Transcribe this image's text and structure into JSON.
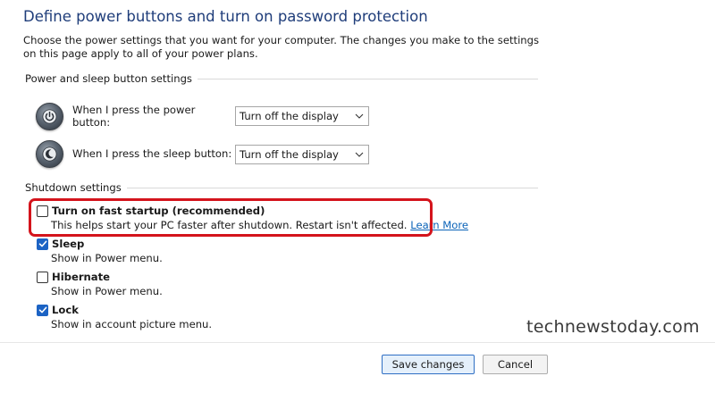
{
  "page": {
    "title": "Define power buttons and turn on password protection",
    "intro": "Choose the power settings that you want for your computer. The changes you make to the settings on this page apply to all of your power plans."
  },
  "power_sleep": {
    "header": "Power and sleep button settings",
    "power_button": {
      "label": "When I press the power button:",
      "value": "Turn off the display",
      "icon": "power-icon"
    },
    "sleep_button": {
      "label": "When I press the sleep button:",
      "value": "Turn off the display",
      "icon": "sleep-icon"
    }
  },
  "shutdown": {
    "header": "Shutdown settings",
    "fast_startup": {
      "title": "Turn on fast startup (recommended)",
      "desc": "This helps start your PC faster after shutdown. Restart isn't affected.",
      "link": "Learn More",
      "checked": false
    },
    "sleep": {
      "title": "Sleep",
      "desc": "Show in Power menu.",
      "checked": true
    },
    "hibernate": {
      "title": "Hibernate",
      "desc": "Show in Power menu.",
      "checked": false
    },
    "lock": {
      "title": "Lock",
      "desc": "Show in account picture menu.",
      "checked": true
    }
  },
  "footer": {
    "save_label": "Save changes",
    "cancel_label": "Cancel"
  },
  "watermark": "technewstoday.com",
  "colors": {
    "title": "#1f3d7a",
    "checkbox_checked": "#1c63c4",
    "highlight": "#d4141c",
    "link": "#0b63b8"
  }
}
